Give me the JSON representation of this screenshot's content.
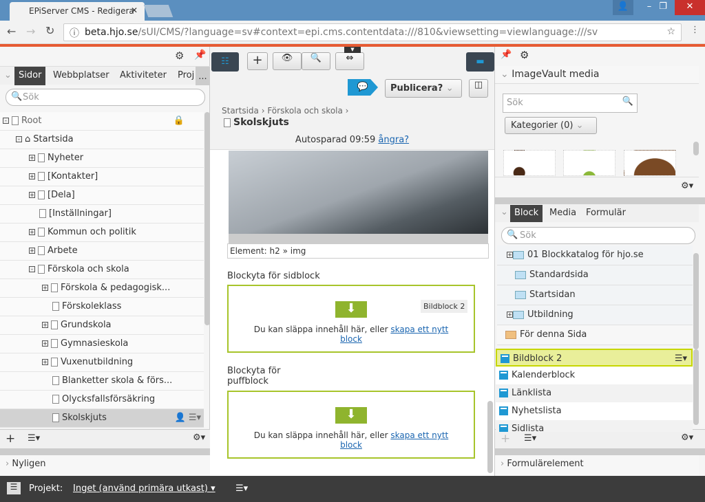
{
  "browser": {
    "tab_title": "EPiServer CMS - Redigera",
    "url_host": "beta.hjo.se",
    "url_path": "/sUI/CMS/?language=sv#context=epi.cms.contentdata:///810&viewsetting=viewlanguage:///sv"
  },
  "left": {
    "tabs": [
      "Sidor",
      "Webbplatser",
      "Aktiviteter",
      "Proj"
    ],
    "more": "...",
    "search_placeholder": "Sök",
    "tree": [
      {
        "label": "Root",
        "level": 0,
        "exp": "-"
      },
      {
        "label": "Startsida",
        "level": 1,
        "exp": "-"
      },
      {
        "label": "Nyheter",
        "level": 2,
        "exp": "+"
      },
      {
        "label": "[Kontakter]",
        "level": 2,
        "exp": "+"
      },
      {
        "label": "[Dela]",
        "level": 2,
        "exp": "+"
      },
      {
        "label": "[Inställningar]",
        "level": 2,
        "exp": ""
      },
      {
        "label": "Kommun och politik",
        "level": 2,
        "exp": "+"
      },
      {
        "label": "Arbete",
        "level": 2,
        "exp": "+"
      },
      {
        "label": "Förskola och skola",
        "level": 2,
        "exp": "-"
      },
      {
        "label": "Förskola & pedagogisk...",
        "level": 3,
        "exp": "+"
      },
      {
        "label": "Förskoleklass",
        "level": 3,
        "exp": ""
      },
      {
        "label": "Grundskola",
        "level": 3,
        "exp": "+"
      },
      {
        "label": "Gymnasieskola",
        "level": 3,
        "exp": "+"
      },
      {
        "label": "Vuxenutbildning",
        "level": 3,
        "exp": "+"
      },
      {
        "label": "Blanketter skola & förs...",
        "level": 3,
        "exp": ""
      },
      {
        "label": "Olycksfallsförsäkring",
        "level": 3,
        "exp": ""
      },
      {
        "label": "Skolskjuts",
        "level": 3,
        "exp": "",
        "selected": true
      }
    ],
    "recent": "Nyligen"
  },
  "center": {
    "publish": "Publicera?",
    "breadcrumb": [
      "Startsida",
      "Förskola och skola"
    ],
    "page_title": "Skolskjuts",
    "autosave": "Autosparad 09:59",
    "undo": "ångra?",
    "element_path": "Element: h2 » img",
    "area1_label": "Blockyta för sidblock",
    "area1_badge": "Bildblock 2",
    "drop_text": "Du kan släppa innehåll här, eller",
    "drop_link": "skapa ett nytt block",
    "area2_label": "Blockyta för puffblock"
  },
  "right": {
    "imagevault_title": "ImageVault media",
    "iv_search_placeholder": "Sök",
    "categories": "Kategorier (0)",
    "tabs": [
      "Block",
      "Media",
      "Formulär"
    ],
    "block_search_placeholder": "Sök",
    "folders": [
      {
        "label": "01 Blockkatalog för hjo.se",
        "exp": true
      },
      {
        "label": "Standardsida",
        "exp": false
      },
      {
        "label": "Startsidan",
        "exp": false
      },
      {
        "label": "Utbildning",
        "exp": true
      }
    ],
    "for_page": "För denna Sida",
    "blocks": [
      "Bildblock 2",
      "Kalenderblock",
      "Länklista",
      "Nyhetslista",
      "Sidlista"
    ],
    "form_elements": "Formulärelement"
  },
  "footer": {
    "project_label": "Projekt:",
    "project_value": "Inget (använd primära utkast)"
  },
  "colors": {
    "accent": "#1f98d3",
    "drop_border": "#a7c42a",
    "highlight": "#e9ef9a",
    "orange": "#e65b33"
  }
}
